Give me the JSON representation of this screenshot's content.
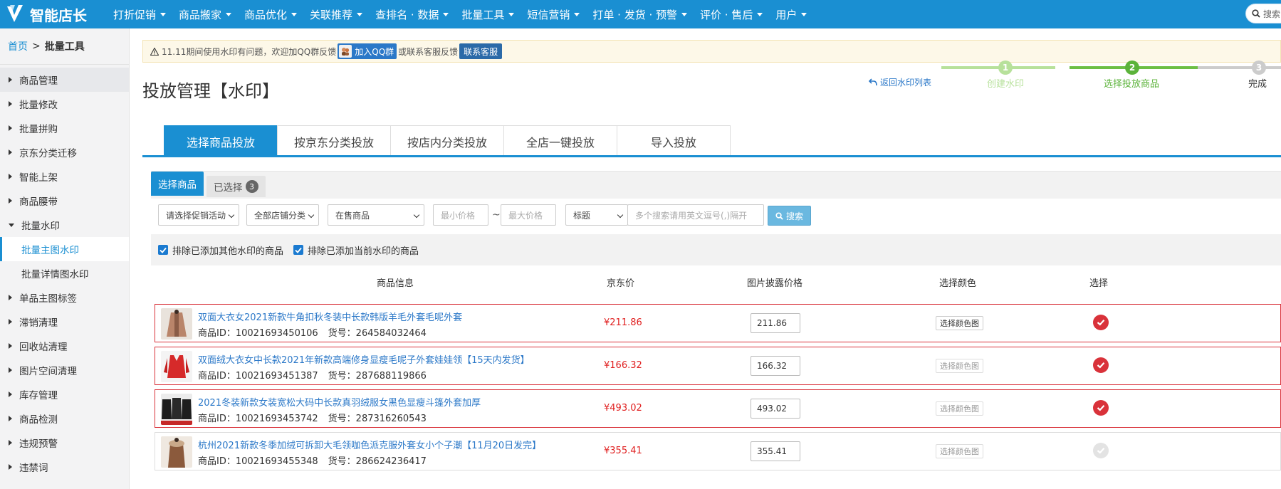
{
  "app": {
    "logo_text": "智能店长"
  },
  "nav": [
    {
      "label": "打折促销",
      "caret": true
    },
    {
      "label": "商品搬家",
      "caret": true
    },
    {
      "label": "商品优化",
      "caret": true
    },
    {
      "label": "关联推荐",
      "caret": true
    },
    {
      "label": "查排名 · 数据",
      "caret": true
    },
    {
      "label": "批量工具",
      "caret": true
    },
    {
      "label": "短信营销",
      "caret": true
    },
    {
      "label": "打单 · 发货 · 预警",
      "caret": true
    },
    {
      "label": "评价 · 售后",
      "caret": true
    },
    {
      "label": "用户",
      "caret": true
    }
  ],
  "top_search": {
    "placeholder": "搜索"
  },
  "breadcrumb": {
    "home": "首页",
    "sep": ">",
    "current": "批量工具"
  },
  "sidebar": {
    "items": [
      {
        "label": "商品管理",
        "expanded": false,
        "active_group": true
      },
      {
        "label": "批量修改",
        "expanded": false
      },
      {
        "label": "批量拼购",
        "expanded": false
      },
      {
        "label": "京东分类迁移",
        "expanded": false
      },
      {
        "label": "智能上架",
        "expanded": false
      },
      {
        "label": "商品腰带",
        "expanded": false
      },
      {
        "label": "批量水印",
        "expanded": true,
        "children": [
          {
            "label": "批量主图水印",
            "active": true
          },
          {
            "label": "批量详情图水印",
            "active": false
          }
        ]
      },
      {
        "label": "单品主图标签",
        "expanded": false
      },
      {
        "label": "滞销清理",
        "expanded": false
      },
      {
        "label": "回收站清理",
        "expanded": false
      },
      {
        "label": "图片空间清理",
        "expanded": false
      },
      {
        "label": "库存管理",
        "expanded": false
      },
      {
        "label": "商品检测",
        "expanded": false
      },
      {
        "label": "违规预警",
        "expanded": false
      },
      {
        "label": "违禁词",
        "expanded": false
      }
    ]
  },
  "notice": {
    "text_before": "11.11期间使用水印有问题，欢迎加QQ群反馈",
    "qq_button": "加入QQ群",
    "text_middle": "或联系客服反馈",
    "service_button": "联系客服"
  },
  "page": {
    "title": "投放管理【水印】",
    "back_link": "返回水印列表"
  },
  "steps": [
    {
      "num": "1",
      "label": "创建水印",
      "state": "done"
    },
    {
      "num": "2",
      "label": "选择投放商品",
      "state": "current"
    },
    {
      "num": "3",
      "label": "完成",
      "state": "todo"
    }
  ],
  "colors": {
    "primary": "#1a8fd2",
    "step_done": "#b7e19b",
    "step_current": "#6cbf45",
    "step_todo": "#cccccc",
    "price": "#e02020",
    "selected_border": "#d9323a"
  },
  "tabs": [
    {
      "label": "选择商品投放",
      "active": true
    },
    {
      "label": "按京东分类投放",
      "active": false
    },
    {
      "label": "按店内分类投放",
      "active": false
    },
    {
      "label": "全店一键投放",
      "active": false
    },
    {
      "label": "导入投放",
      "active": false
    }
  ],
  "subtabs": {
    "select_label": "选择商品",
    "selected_label": "已选择",
    "selected_count": "3"
  },
  "filters": {
    "promo": "请选择促销活动",
    "category": "全部店铺分类",
    "status": "在售商品",
    "min_price_placeholder": "最小价格",
    "tilde": "~",
    "max_price_placeholder": "最大价格",
    "field": "标题",
    "keyword_placeholder": "多个搜索请用英文逗号(,)隔开",
    "search_button": "搜索"
  },
  "checkboxes": [
    {
      "label": "排除已添加其他水印的商品",
      "checked": true
    },
    {
      "label": "排除已添加当前水印的商品",
      "checked": true
    }
  ],
  "table": {
    "headers": {
      "info": "商品信息",
      "jd_price": "京东价",
      "img_price": "图片披露价格",
      "color": "选择颜色",
      "select": "选择"
    },
    "id_label": "商品ID：",
    "sku_label": "货号：",
    "color_button": "选择颜色图",
    "rows": [
      {
        "title": "双面大衣女2021新款牛角扣秋冬装中长款韩版羊毛外套毛呢外套",
        "id": "10021693450106",
        "sku": "264584032464",
        "price": "¥211.86",
        "img_price": "211.86",
        "selected": true,
        "thumb": "coat-beige"
      },
      {
        "title": "双面绒大衣女中长款2021年新款高端修身显瘦毛呢子外套娃娃领【15天内发货】",
        "id": "10021693451387",
        "sku": "287688119866",
        "price": "¥166.32",
        "img_price": "166.32",
        "selected": true,
        "thumb": "coat-red"
      },
      {
        "title": "2021冬装新款女装宽松大码中长款真羽绒服女黑色显瘦斗篷外套加厚",
        "id": "10021693453742",
        "sku": "287316260543",
        "price": "¥493.02",
        "img_price": "493.02",
        "selected": true,
        "thumb": "coat-black"
      },
      {
        "title": "杭州2021新款冬季加绒可拆卸大毛领咖色派克服外套女小个子潮【11月20日发完】",
        "id": "10021693455348",
        "sku": "286624236417",
        "price": "¥355.41",
        "img_price": "355.41",
        "selected": false,
        "thumb": "coat-brown"
      }
    ]
  }
}
